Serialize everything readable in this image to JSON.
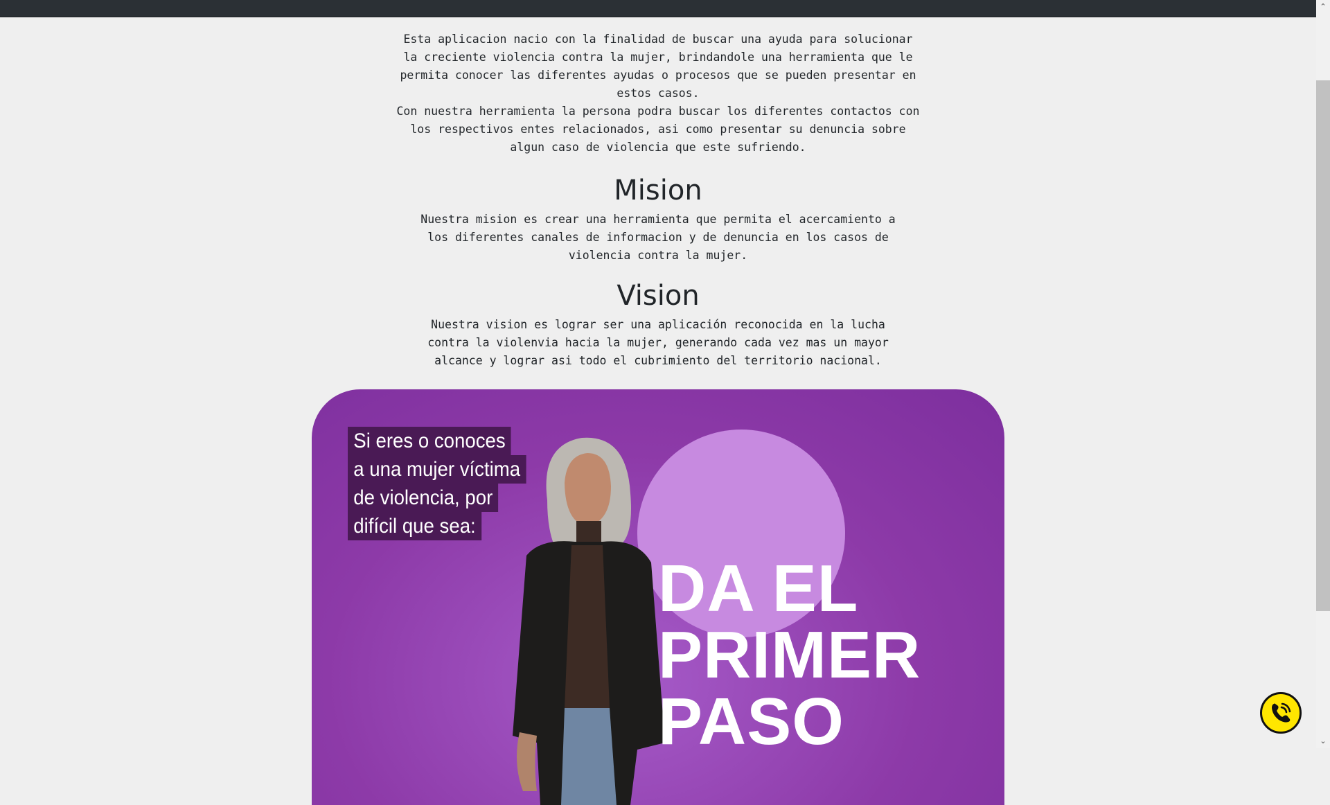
{
  "intro": {
    "p1": "Esta aplicacion nacio con la finalidad de buscar una ayuda para solucionar la creciente violencia contra la mujer, brindandole una herramienta que le permita conocer las diferentes ayudas o procesos que se pueden presentar en estos casos.",
    "p2": "Con nuestra herramienta la persona podra buscar los diferentes contactos con los respectivos entes relacionados, asi como presentar su denuncia sobre algun caso de violencia que este sufriendo."
  },
  "mision": {
    "title": "Mision",
    "text": "Nuestra mision es crear una herramienta que permita el acercamiento a los diferentes canales de informacion y de denuncia en los casos de violencia contra la mujer."
  },
  "vision": {
    "title": "Vision",
    "text": "Nuestra vision es lograr ser una aplicación reconocida en la lucha contra la violenvia hacia la mujer, generando cada vez mas un mayor alcance y lograr asi todo el cubrimiento del territorio nacional."
  },
  "banner": {
    "intro_lines": [
      "Si eres o conoces",
      "a una mujer víctima",
      "de violencia, por",
      "difícil que sea:"
    ],
    "headline_lines": [
      "DA EL",
      "PRIMER",
      "PASO"
    ]
  },
  "icons": {
    "call": "phone-call-icon",
    "scroll_up": "chevron-up-icon",
    "scroll_down": "chevron-down-icon"
  },
  "colors": {
    "banner_purple": "#8d3aa8",
    "banner_circle": "#c78ae0",
    "call_button": "#ffe600",
    "topbar": "#2b3035"
  }
}
